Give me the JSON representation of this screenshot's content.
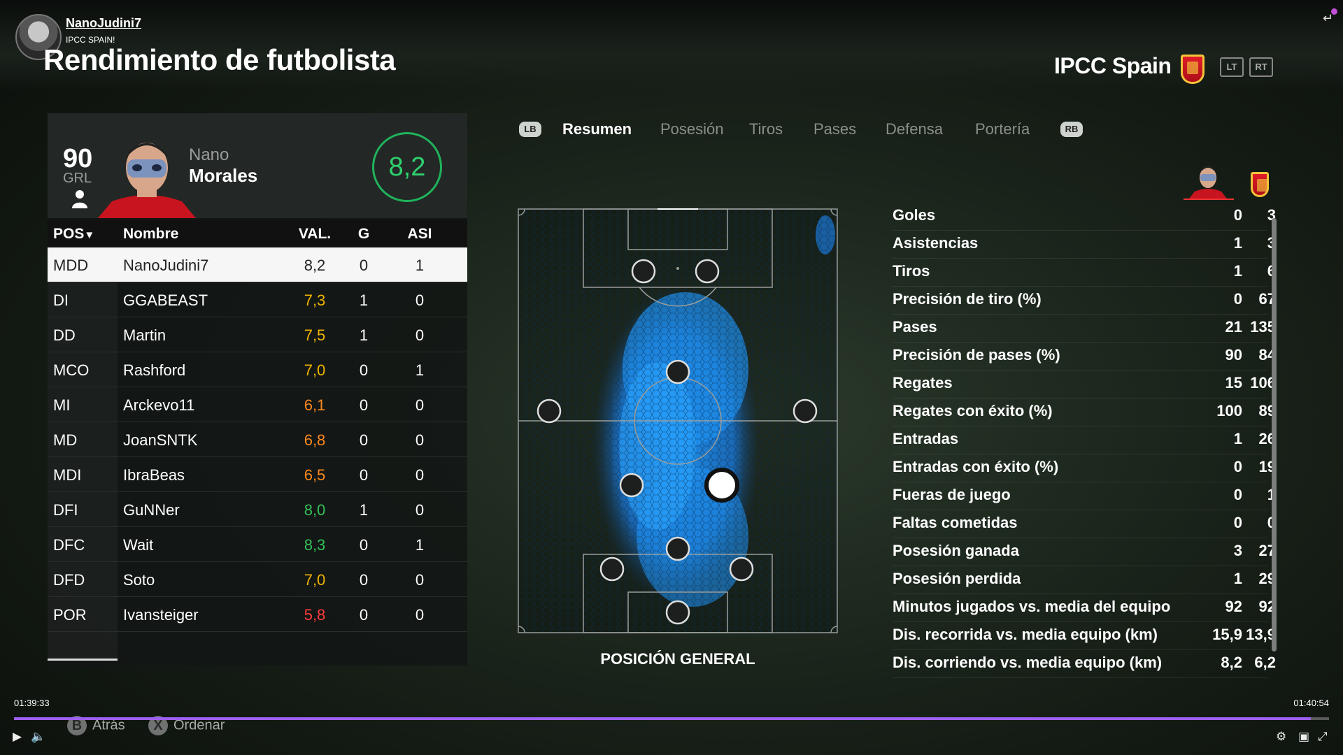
{
  "stream": {
    "user_name": "NanoJudini7",
    "user_subtitle": "IPCC SPAIN!",
    "time_current": "01:39:33",
    "time_total": "01:40:54",
    "progress": 0.986
  },
  "header": {
    "title": "Rendimiento de futbolista",
    "team_name": "IPCC Spain",
    "lt_label": "LT",
    "rt_label": "RT"
  },
  "player": {
    "grl": "90",
    "grl_label": "GRL",
    "first_name": "Nano",
    "last_name": "Morales",
    "rating": "8,2"
  },
  "table": {
    "headers": {
      "pos": "POS",
      "name": "Nombre",
      "val": "VAL.",
      "g": "G",
      "asi": "ASI"
    },
    "rows": [
      {
        "pos": "MDD",
        "name": "NanoJudini7",
        "val": "8,2",
        "g": "0",
        "asi": "1",
        "color": "#222222",
        "selected": true
      },
      {
        "pos": "DI",
        "name": "GGABEAST",
        "val": "7,3",
        "g": "1",
        "asi": "0",
        "color": "#f0b400"
      },
      {
        "pos": "DD",
        "name": "Martin",
        "val": "7,5",
        "g": "1",
        "asi": "0",
        "color": "#f0b400"
      },
      {
        "pos": "MCO",
        "name": "Rashford",
        "val": "7,0",
        "g": "0",
        "asi": "1",
        "color": "#f0b400"
      },
      {
        "pos": "MI",
        "name": "Arckevo11",
        "val": "6,1",
        "g": "0",
        "asi": "0",
        "color": "#ff8a1c"
      },
      {
        "pos": "MD",
        "name": "JoanSNTK",
        "val": "6,8",
        "g": "0",
        "asi": "0",
        "color": "#ff8a1c"
      },
      {
        "pos": "MDI",
        "name": "IbraBeas",
        "val": "6,5",
        "g": "0",
        "asi": "0",
        "color": "#ff8a1c"
      },
      {
        "pos": "DFI",
        "name": "GuNNer",
        "val": "8,0",
        "g": "1",
        "asi": "0",
        "color": "#33c25a"
      },
      {
        "pos": "DFC",
        "name": "Wait",
        "val": "8,3",
        "g": "0",
        "asi": "1",
        "color": "#33c25a"
      },
      {
        "pos": "DFD",
        "name": "Soto",
        "val": "7,0",
        "g": "0",
        "asi": "0",
        "color": "#f0b400"
      },
      {
        "pos": "POR",
        "name": "Ivansteiger",
        "val": "5,8",
        "g": "0",
        "asi": "0",
        "color": "#ff3b3b"
      }
    ]
  },
  "tabs": {
    "lb": "LB",
    "rb": "RB",
    "items": [
      "Resumen",
      "Posesión",
      "Tiros",
      "Pases",
      "Defensa",
      "Portería"
    ],
    "active": 0
  },
  "pitch": {
    "label": "POSICIÓN GENERAL"
  },
  "stats": [
    {
      "label": "Goles",
      "player": "0",
      "team": "3"
    },
    {
      "label": "Asistencias",
      "player": "1",
      "team": "3"
    },
    {
      "label": "Tiros",
      "player": "1",
      "team": "6"
    },
    {
      "label": "Precisión de tiro (%)",
      "player": "0",
      "team": "67"
    },
    {
      "label": "Pases",
      "player": "21",
      "team": "135"
    },
    {
      "label": "Precisión de pases (%)",
      "player": "90",
      "team": "84"
    },
    {
      "label": "Regates",
      "player": "15",
      "team": "106"
    },
    {
      "label": "Regates con éxito (%)",
      "player": "100",
      "team": "89"
    },
    {
      "label": "Entradas",
      "player": "1",
      "team": "26"
    },
    {
      "label": "Entradas con éxito (%)",
      "player": "0",
      "team": "19"
    },
    {
      "label": "Fueras de juego",
      "player": "0",
      "team": "1"
    },
    {
      "label": "Faltas cometidas",
      "player": "0",
      "team": "0"
    },
    {
      "label": "Posesión ganada",
      "player": "3",
      "team": "27"
    },
    {
      "label": "Posesión perdida",
      "player": "1",
      "team": "29"
    },
    {
      "label": "Minutos jugados vs. media del equipo",
      "player": "92",
      "team": "92"
    },
    {
      "label": "Dis. recorrida vs. media equipo (km)",
      "player": "15,9",
      "team": "13,9"
    },
    {
      "label": "Dis. corriendo vs. media equipo (km)",
      "player": "8,2",
      "team": "6,2"
    }
  ],
  "hints": {
    "back_key": "B",
    "back_label": "Atrás",
    "sort_key": "X",
    "sort_label": "Ordenar"
  },
  "colors": {
    "accent_progress": "#9e5ff4",
    "rating_green": "#2fd06e",
    "heatmap": "#1e90f0"
  }
}
